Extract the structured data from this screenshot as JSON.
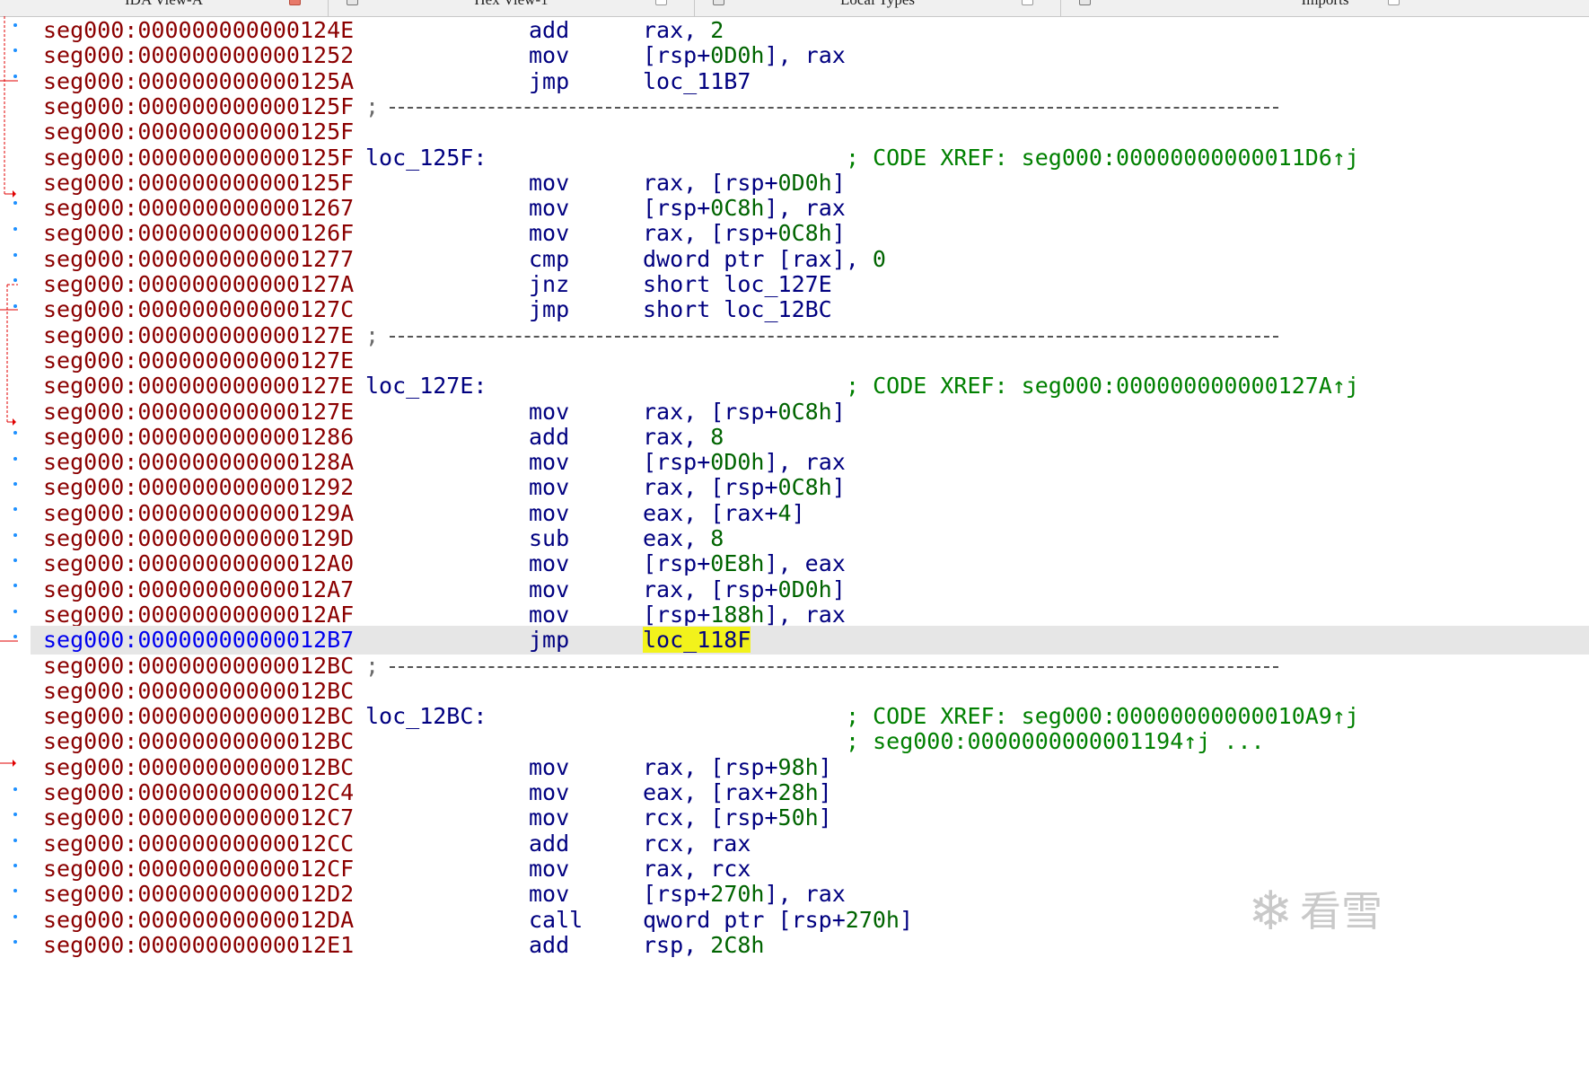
{
  "tabs": [
    {
      "label": "IDA View-A",
      "active": true
    },
    {
      "label": "Hex View-1",
      "active": false
    },
    {
      "label": "Local Types",
      "active": false
    },
    {
      "label": "Imports",
      "active": false
    }
  ],
  "watermark_text": "看雪",
  "rows": [
    {
      "addr": "seg000:000000000000124E",
      "mnemonic": "add",
      "operands": [
        {
          "t": "rax, "
        },
        {
          "t": "2",
          "c": "num"
        }
      ]
    },
    {
      "addr": "seg000:0000000000001252",
      "mnemonic": "mov",
      "operands": [
        {
          "t": "[rsp+"
        },
        {
          "t": "0D0h",
          "c": "num"
        },
        {
          "t": "], rax"
        }
      ]
    },
    {
      "addr": "seg000:000000000000125A",
      "mnemonic": "jmp",
      "operands": [
        {
          "t": "loc_11B7"
        }
      ]
    },
    {
      "addr": "seg000:000000000000125F",
      "separator": true
    },
    {
      "addr": "seg000:000000000000125F"
    },
    {
      "addr": "seg000:000000000000125F",
      "label": "loc_125F:",
      "comment": "; CODE XREF: seg000:00000000000011D6↑j"
    },
    {
      "addr": "seg000:000000000000125F",
      "mnemonic": "mov",
      "operands": [
        {
          "t": "rax, [rsp+"
        },
        {
          "t": "0D0h",
          "c": "num"
        },
        {
          "t": "]"
        }
      ]
    },
    {
      "addr": "seg000:0000000000001267",
      "mnemonic": "mov",
      "operands": [
        {
          "t": "[rsp+"
        },
        {
          "t": "0C8h",
          "c": "num"
        },
        {
          "t": "], rax"
        }
      ]
    },
    {
      "addr": "seg000:000000000000126F",
      "mnemonic": "mov",
      "operands": [
        {
          "t": "rax, [rsp+"
        },
        {
          "t": "0C8h",
          "c": "num"
        },
        {
          "t": "]"
        }
      ]
    },
    {
      "addr": "seg000:0000000000001277",
      "mnemonic": "cmp",
      "operands": [
        {
          "t": "dword ptr [rax], "
        },
        {
          "t": "0",
          "c": "num"
        }
      ]
    },
    {
      "addr": "seg000:000000000000127A",
      "mnemonic": "jnz",
      "operands": [
        {
          "t": "short loc_127E"
        }
      ]
    },
    {
      "addr": "seg000:000000000000127C",
      "mnemonic": "jmp",
      "operands": [
        {
          "t": "short loc_12BC"
        }
      ]
    },
    {
      "addr": "seg000:000000000000127E",
      "separator": true
    },
    {
      "addr": "seg000:000000000000127E"
    },
    {
      "addr": "seg000:000000000000127E",
      "label": "loc_127E:",
      "comment": "; CODE XREF: seg000:000000000000127A↑j"
    },
    {
      "addr": "seg000:000000000000127E",
      "mnemonic": "mov",
      "operands": [
        {
          "t": "rax, [rsp+"
        },
        {
          "t": "0C8h",
          "c": "num"
        },
        {
          "t": "]"
        }
      ]
    },
    {
      "addr": "seg000:0000000000001286",
      "mnemonic": "add",
      "operands": [
        {
          "t": "rax, "
        },
        {
          "t": "8",
          "c": "num"
        }
      ]
    },
    {
      "addr": "seg000:000000000000128A",
      "mnemonic": "mov",
      "operands": [
        {
          "t": "[rsp+"
        },
        {
          "t": "0D0h",
          "c": "num"
        },
        {
          "t": "], rax"
        }
      ]
    },
    {
      "addr": "seg000:0000000000001292",
      "mnemonic": "mov",
      "operands": [
        {
          "t": "rax, [rsp+"
        },
        {
          "t": "0C8h",
          "c": "num"
        },
        {
          "t": "]"
        }
      ]
    },
    {
      "addr": "seg000:000000000000129A",
      "mnemonic": "mov",
      "operands": [
        {
          "t": "eax, [rax+"
        },
        {
          "t": "4",
          "c": "num"
        },
        {
          "t": "]"
        }
      ]
    },
    {
      "addr": "seg000:000000000000129D",
      "mnemonic": "sub",
      "operands": [
        {
          "t": "eax, "
        },
        {
          "t": "8",
          "c": "num"
        }
      ]
    },
    {
      "addr": "seg000:00000000000012A0",
      "mnemonic": "mov",
      "operands": [
        {
          "t": "[rsp+"
        },
        {
          "t": "0E8h",
          "c": "num"
        },
        {
          "t": "], eax"
        }
      ]
    },
    {
      "addr": "seg000:00000000000012A7",
      "mnemonic": "mov",
      "operands": [
        {
          "t": "rax, [rsp+"
        },
        {
          "t": "0D0h",
          "c": "num"
        },
        {
          "t": "]"
        }
      ]
    },
    {
      "addr": "seg000:00000000000012AF",
      "mnemonic": "mov",
      "operands": [
        {
          "t": "[rsp+"
        },
        {
          "t": "188h",
          "c": "num"
        },
        {
          "t": "], rax"
        }
      ]
    },
    {
      "addr": "seg000:00000000000012B7",
      "mnemonic": "jmp",
      "operands": [
        {
          "t": "loc_118F",
          "c": "hlop"
        }
      ],
      "highlight": true
    },
    {
      "addr": "seg000:00000000000012BC",
      "separator": true
    },
    {
      "addr": "seg000:00000000000012BC"
    },
    {
      "addr": "seg000:00000000000012BC",
      "label": "loc_12BC:",
      "comment": "; CODE XREF: seg000:00000000000010A9↑j"
    },
    {
      "addr": "seg000:00000000000012BC",
      "comment": "; seg000:0000000000001194↑j ..."
    },
    {
      "addr": "seg000:00000000000012BC",
      "mnemonic": "mov",
      "operands": [
        {
          "t": "rax, [rsp+"
        },
        {
          "t": "98h",
          "c": "num"
        },
        {
          "t": "]"
        }
      ]
    },
    {
      "addr": "seg000:00000000000012C4",
      "mnemonic": "mov",
      "operands": [
        {
          "t": "eax, [rax+"
        },
        {
          "t": "28h",
          "c": "num"
        },
        {
          "t": "]"
        }
      ]
    },
    {
      "addr": "seg000:00000000000012C7",
      "mnemonic": "mov",
      "operands": [
        {
          "t": "rcx, [rsp+"
        },
        {
          "t": "50h",
          "c": "num"
        },
        {
          "t": "]"
        }
      ]
    },
    {
      "addr": "seg000:00000000000012CC",
      "mnemonic": "add",
      "operands": [
        {
          "t": "rcx, rax"
        }
      ]
    },
    {
      "addr": "seg000:00000000000012CF",
      "mnemonic": "mov",
      "operands": [
        {
          "t": "rax, rcx"
        }
      ]
    },
    {
      "addr": "seg000:00000000000012D2",
      "mnemonic": "mov",
      "operands": [
        {
          "t": "[rsp+"
        },
        {
          "t": "270h",
          "c": "num"
        },
        {
          "t": "], rax"
        }
      ]
    },
    {
      "addr": "seg000:00000000000012DA",
      "mnemonic": "call",
      "operands": [
        {
          "t": "qword ptr [rsp+"
        },
        {
          "t": "270h",
          "c": "num"
        },
        {
          "t": "]"
        }
      ]
    },
    {
      "addr": "seg000:00000000000012E1",
      "mnemonic": "add",
      "operands": [
        {
          "t": "rsp, "
        },
        {
          "t": "2C8h",
          "c": "num"
        }
      ]
    }
  ]
}
